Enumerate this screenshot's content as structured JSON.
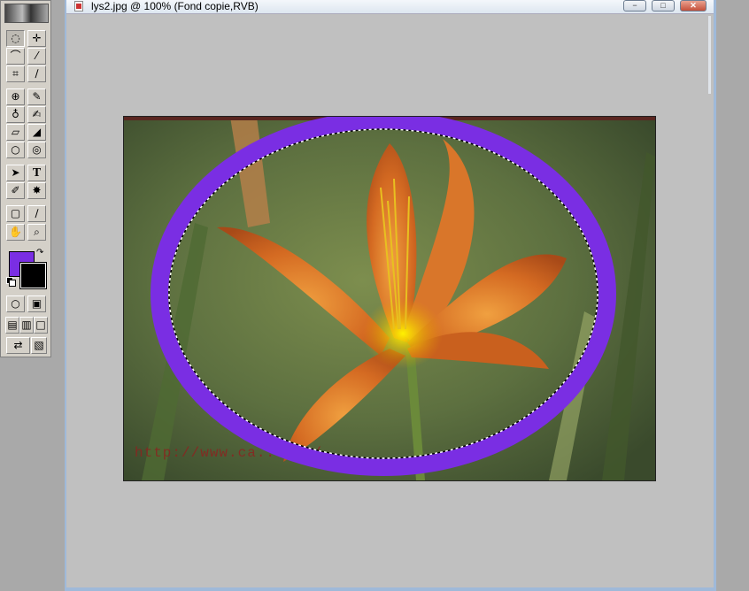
{
  "document": {
    "title": "lys2.jpg @ 100% (Fond copie,RVB)",
    "watermark": "http://www.ca...com/"
  },
  "window_controls": {
    "minimize": "−",
    "maximize": "□",
    "close": "✕"
  },
  "toolbox": {
    "tool_glyphs": {
      "marquee": "◌",
      "move": "✛",
      "lasso": "⌒",
      "magic-wand": "⁄",
      "crop": "⌗",
      "slice": "∕",
      "healing": "⊕",
      "brush": "✎",
      "stamp": "♁",
      "history-brush": "✍",
      "eraser": "▱",
      "bucket": "◢",
      "blur": "○",
      "dodge": "◎",
      "path-select": "➤",
      "type": "T",
      "pen": "✐",
      "shape": "✸",
      "notes": "▢",
      "eyedropper": "∕",
      "hand": "✋",
      "zoom": "⌕",
      "std-mode": "○",
      "quickmask": "▣",
      "screen-std": "▤",
      "screen-full-menu": "▥",
      "screen-full": "□",
      "jump-to": "⇄",
      "extra": "▧"
    },
    "foreground_color": "#7a2ee3",
    "background_color": "#000000",
    "swap": "↷"
  },
  "colors": {
    "selection_frame": "#7a2ee3",
    "window_frame": "#9fb9d9"
  }
}
